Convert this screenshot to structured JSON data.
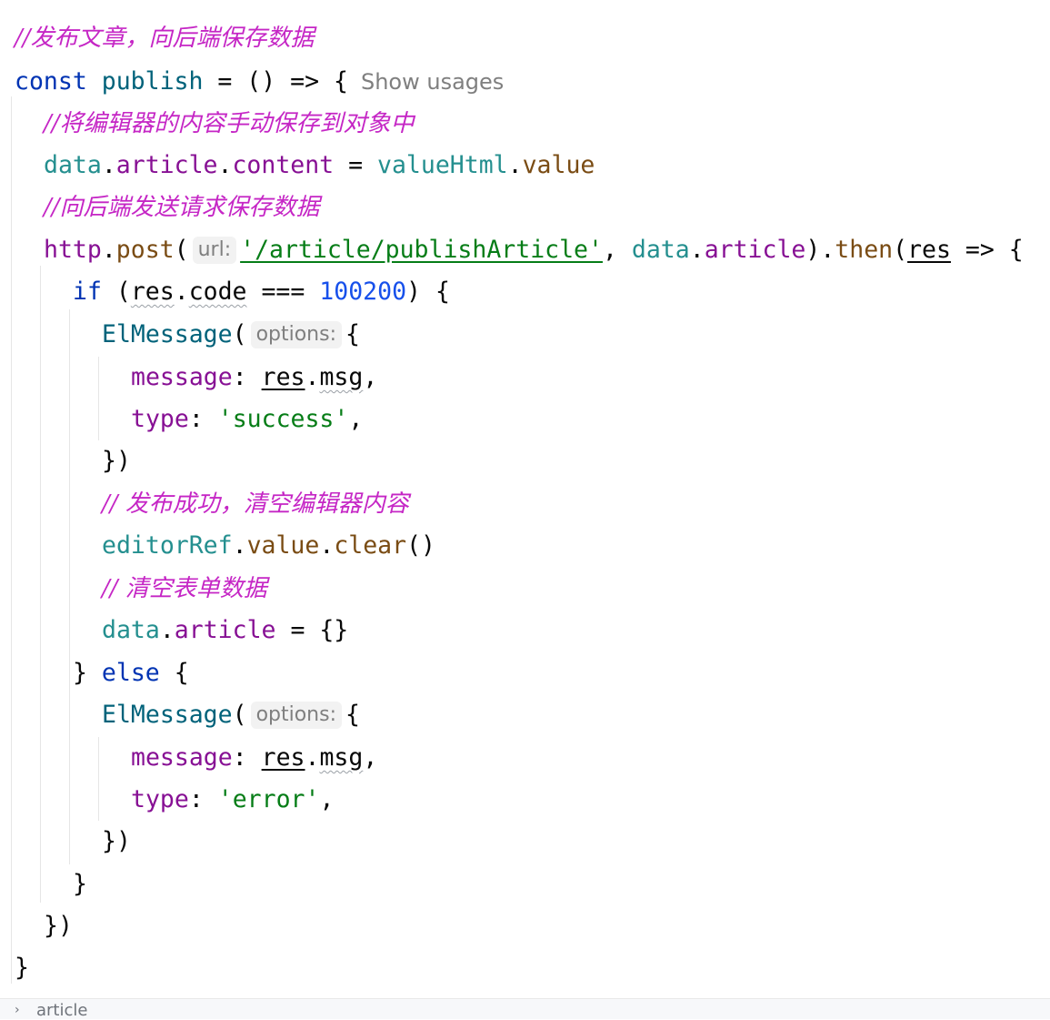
{
  "editor": {
    "comment_publish": "//发布文章，向后端保存数据",
    "kw_const": "const",
    "fn_publish": "publish",
    "arrow_open": " = () => {",
    "show_usages": "Show usages",
    "comment_save_editor": "//将编辑器的内容手动保存到对象中",
    "assign_content": {
      "data": "data",
      "article": "article",
      "content": "content",
      "eq": " = ",
      "valueHtml": "valueHtml",
      "value": "value"
    },
    "comment_send": "//向后端发送请求保存数据",
    "post_line": {
      "http": "http",
      "post": "post",
      "hint_url": "url:",
      "url": "'/article/publishArticle'",
      "data": "data",
      "article": "article",
      "then": "then",
      "res": "res",
      "arrow": " => {"
    },
    "if_line": {
      "kw_if": "if",
      "res": "res",
      "code": "code",
      "op": " === ",
      "num": "100200",
      "tail": ") {"
    },
    "elmessage": "ElMessage",
    "hint_options": "options:",
    "message_key": "message",
    "res": "res",
    "msg": "msg",
    "type_key": "type",
    "type_success": "'success'",
    "type_error": "'error'",
    "close_obj": "})",
    "comment_publish_ok": "// 发布成功，清空编辑器内容",
    "editor_clear": {
      "editorRef": "editorRef",
      "value": "value",
      "clear": "clear",
      "tail": "()"
    },
    "comment_clear_form": "// 清空表单数据",
    "reset_article": {
      "data": "data",
      "article": "article",
      "tail": " = {}"
    },
    "kw_else": "else",
    "close_brace": "}"
  },
  "status_bar": {
    "breadcrumb": "article"
  }
}
